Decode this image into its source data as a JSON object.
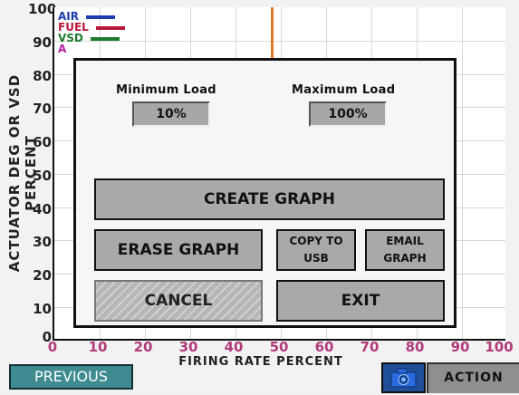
{
  "y_axis": {
    "label": "ACTUATOR DEG OR VSD PERCENT",
    "ticks": [
      "100",
      "90",
      "80",
      "70",
      "60",
      "50",
      "40",
      "30",
      "20",
      "10",
      "0"
    ]
  },
  "x_axis": {
    "label": "FIRING RATE PERCENT",
    "ticks": [
      "0",
      "10",
      "20",
      "30",
      "40",
      "50",
      "60",
      "70",
      "80",
      "90",
      "100"
    ]
  },
  "legend": {
    "items": [
      {
        "label": "AIR",
        "color": "#1f3db0"
      },
      {
        "label": "FUEL",
        "color": "#b9163b"
      },
      {
        "label": "VSD",
        "color": "#1d7b2d"
      },
      {
        "label": "A",
        "color": "#b1249b"
      }
    ]
  },
  "modal": {
    "min_title": "Minimum Load",
    "max_title": "Maximum Load",
    "min_value": "10%",
    "max_value": "100%",
    "buttons": {
      "create": "CREATE GRAPH",
      "erase": "ERASE GRAPH",
      "copy_line1": "COPY TO",
      "copy_line2": "USB",
      "email_line1": "EMAIL",
      "email_line2": "GRAPH",
      "cancel": "CANCEL",
      "exit": "EXIT"
    }
  },
  "bottom_bar": {
    "previous": "PREVIOUS",
    "action": "ACTION",
    "camera_icon": "camera-icon"
  },
  "colors": {
    "orange_marker": "#e07a28",
    "previous_button": "#3e8b91",
    "camera_button": "#1f4f98"
  }
}
